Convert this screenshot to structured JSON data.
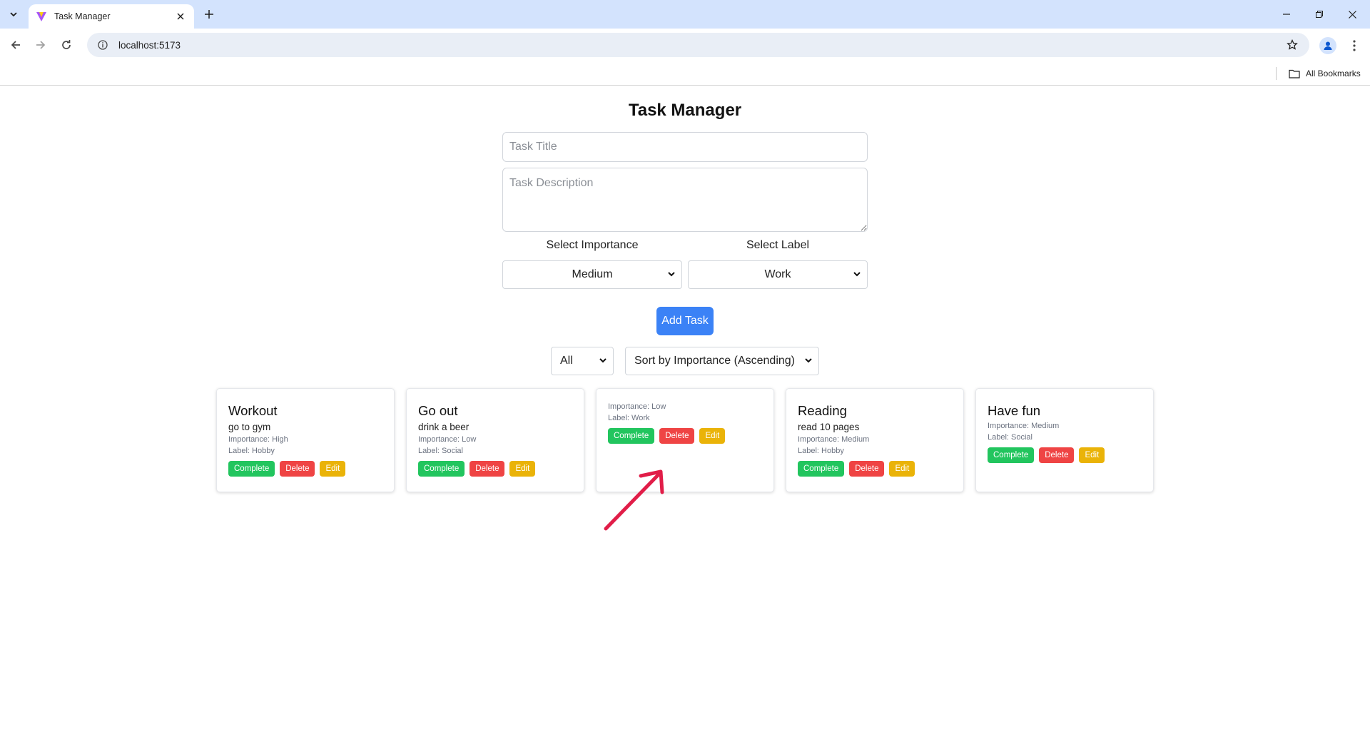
{
  "browser": {
    "tab_title": "Task Manager",
    "url": "localhost:5173",
    "bookmarks_label": "All Bookmarks"
  },
  "app": {
    "title": "Task Manager",
    "title_placeholder": "Task Title",
    "description_placeholder": "Task Description",
    "importance_label": "Select Importance",
    "importance_value": "Medium",
    "label_label": "Select Label",
    "label_value": "Work",
    "add_button": "Add Task",
    "filter_value": "All",
    "sort_value": "Sort by Importance (Ascending)"
  },
  "tasks": [
    {
      "title": "Workout",
      "description": "go to gym",
      "importance": "Importance: High",
      "label": "Label: Hobby",
      "complete": "Complete",
      "delete": "Delete",
      "edit": "Edit"
    },
    {
      "title": "Go out",
      "description": "drink a beer",
      "importance": "Importance: Low",
      "label": "Label: Social",
      "complete": "Complete",
      "delete": "Delete",
      "edit": "Edit"
    },
    {
      "title": "",
      "description": "",
      "importance": "Importance: Low",
      "label": "Label: Work",
      "complete": "Complete",
      "delete": "Delete",
      "edit": "Edit"
    },
    {
      "title": "Reading",
      "description": "read 10 pages",
      "importance": "Importance: Medium",
      "label": "Label: Hobby",
      "complete": "Complete",
      "delete": "Delete",
      "edit": "Edit"
    },
    {
      "title": "Have fun",
      "description": "",
      "importance": "Importance: Medium",
      "label": "Label: Social",
      "complete": "Complete",
      "delete": "Delete",
      "edit": "Edit"
    }
  ],
  "colors": {
    "complete": "#22c55e",
    "delete": "#ef4444",
    "edit": "#eab308",
    "primary": "#3b82f6",
    "annotation_arrow": "#e11d48"
  }
}
